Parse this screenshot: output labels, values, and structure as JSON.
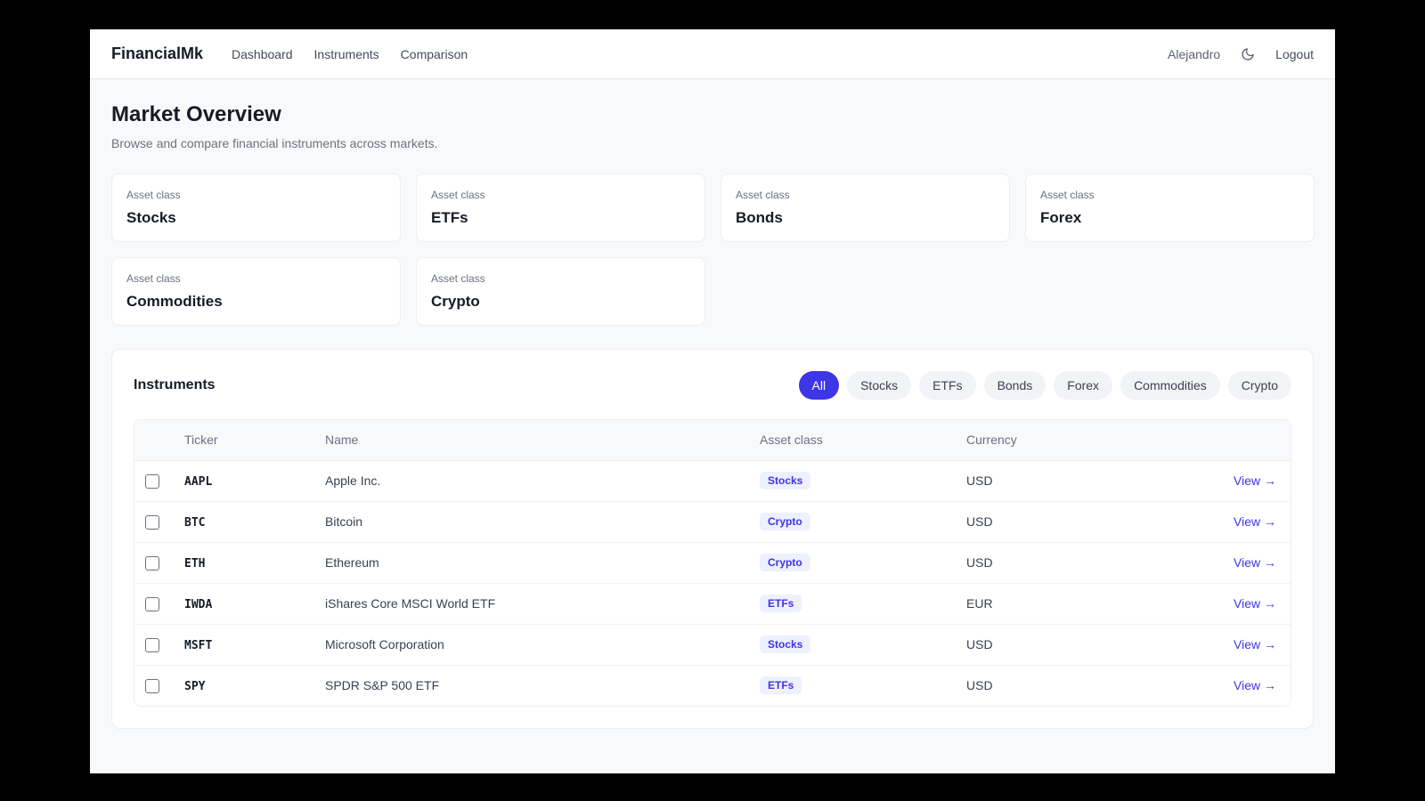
{
  "nav": {
    "brand": "FinancialMk",
    "links": [
      "Dashboard",
      "Instruments",
      "Comparison"
    ],
    "user": "Alejandro",
    "theme_icon": "moon-icon",
    "logout": "Logout"
  },
  "header": {
    "title": "Market Overview",
    "subtitle": "Browse and compare financial instruments across markets."
  },
  "asset_classes": [
    {
      "kicker": "Asset class",
      "value": "Stocks"
    },
    {
      "kicker": "Asset class",
      "value": "ETFs"
    },
    {
      "kicker": "Asset class",
      "value": "Bonds"
    },
    {
      "kicker": "Asset class",
      "value": "Forex"
    },
    {
      "kicker": "Asset class",
      "value": "Commodities"
    },
    {
      "kicker": "Asset class",
      "value": "Crypto"
    }
  ],
  "instruments": {
    "title": "Instruments",
    "filters": [
      "All",
      "Stocks",
      "ETFs",
      "Bonds",
      "Forex",
      "Commodities",
      "Crypto"
    ],
    "active_filter": "All",
    "columns": {
      "ticker": "Ticker",
      "name": "Name",
      "asset_class": "Asset class",
      "currency": "Currency"
    },
    "rows": [
      {
        "ticker": "AAPL",
        "name": "Apple Inc.",
        "asset_class": "Stocks",
        "currency": "USD",
        "action": "View →"
      },
      {
        "ticker": "BTC",
        "name": "Bitcoin",
        "asset_class": "Crypto",
        "currency": "USD",
        "action": "View →"
      },
      {
        "ticker": "ETH",
        "name": "Ethereum",
        "asset_class": "Crypto",
        "currency": "USD",
        "action": "View →"
      },
      {
        "ticker": "IWDA",
        "name": "iShares Core MSCI World ETF",
        "asset_class": "ETFs",
        "currency": "EUR",
        "action": "View →"
      },
      {
        "ticker": "MSFT",
        "name": "Microsoft Corporation",
        "asset_class": "Stocks",
        "currency": "USD",
        "action": "View →"
      },
      {
        "ticker": "SPY",
        "name": "SPDR S&P 500 ETF",
        "asset_class": "ETFs",
        "currency": "USD",
        "action": "View →"
      }
    ]
  },
  "colors": {
    "accent": "#3d35e8",
    "badge_bg": "#eef0fe",
    "page_bg": "#f8f9fb"
  }
}
